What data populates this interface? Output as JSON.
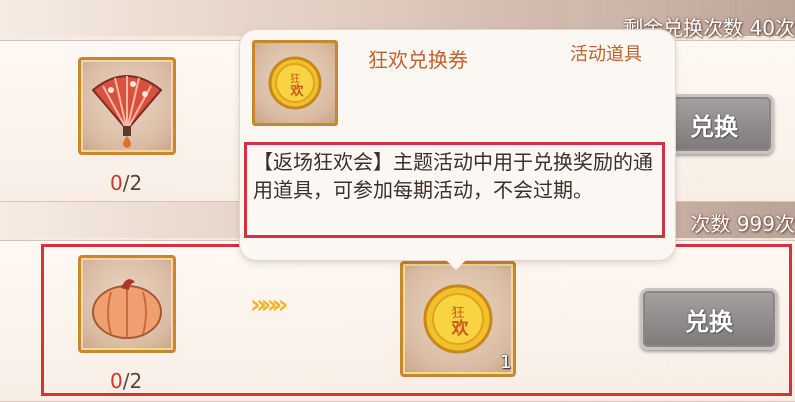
{
  "rows": [
    {
      "remaining_text": "剩余兑换次数 40次",
      "cost_item_icon": "folding-fan-icon",
      "cost_have": "0",
      "cost_need": "/2",
      "button_label": "兑换"
    },
    {
      "remaining_text": "次数 999次",
      "cost_item_icon": "pumpkin-icon",
      "cost_have": "0",
      "cost_need": "/2",
      "arrows": "»»»",
      "reward_item_icon": "carnival-coin-icon",
      "reward_qty": "1",
      "button_label": "兑换"
    }
  ],
  "tooltip": {
    "item_icon": "carnival-coin-icon",
    "name": "狂欢兑换券",
    "type": "活动道具",
    "description": "【返场狂欢会】主题活动中用于兑换奖励的通用道具，可参加每期活动，不会过期。",
    "coin_glyphs": "狂欢"
  },
  "colors": {
    "frame_orange": "#c9862e",
    "highlight_red": "#d3333c",
    "count_red": "#d1352b",
    "arrow_gold": "#f0b52a",
    "button_gray": "#8f8a89"
  }
}
